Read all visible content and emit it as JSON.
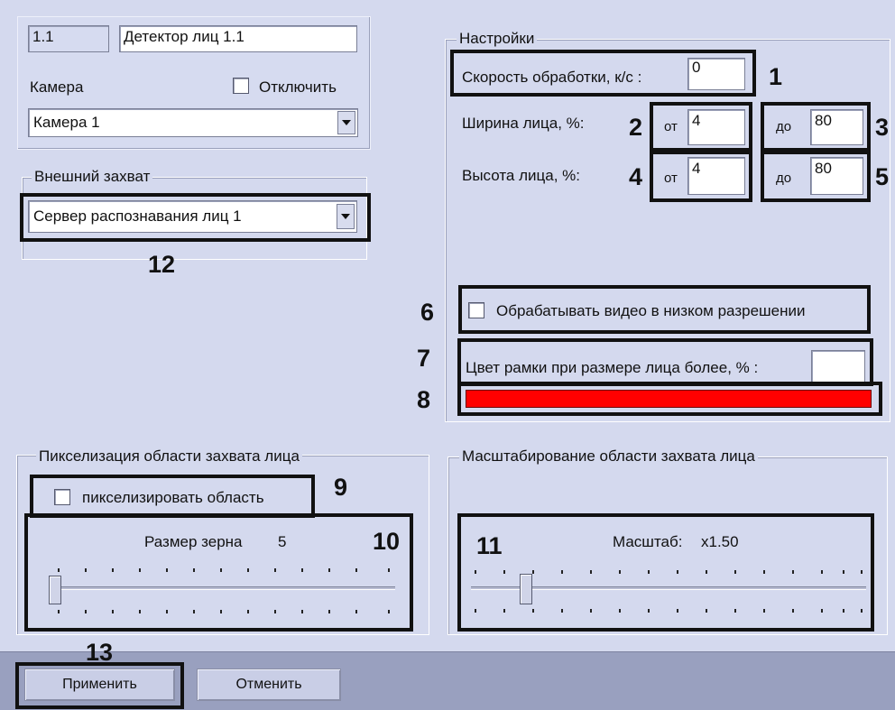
{
  "top_panel": {
    "id_value": "1.1",
    "name_value": "Детектор лиц 1.1",
    "camera_label": "Камера",
    "disable_label": "Отключить",
    "camera_selected": "Камера 1"
  },
  "external_capture": {
    "legend": "Внешний захват",
    "selected": "Сервер распознавания лиц 1"
  },
  "settings": {
    "legend": "Настройки",
    "speed_label": "Скорость обработки, к/с :",
    "speed_value": "0",
    "width_label": "Ширина лица, %:",
    "height_label": "Высота лица, %:",
    "from_label": "от",
    "to_label": "до",
    "width_from": "4",
    "width_to": "80",
    "height_from": "4",
    "height_to": "80",
    "low_res_label": "Обрабатывать видео в низком разрешении",
    "frame_color_label": "Цвет рамки при размере лица более, % :",
    "frame_color_value": "",
    "frame_color": "#ff0000"
  },
  "pixelization": {
    "legend": "Пикселизация области захвата лица",
    "pixelize_label": "пикселизировать область",
    "grain_label": "Размер зерна",
    "grain_value": "5"
  },
  "scaling": {
    "legend": "Масштабирование области захвата лица",
    "scale_label": "Масштаб:",
    "scale_value": "x1.50"
  },
  "buttons": {
    "apply": "Применить",
    "cancel": "Отменить"
  },
  "callouts": [
    "1",
    "2",
    "3",
    "4",
    "5",
    "6",
    "7",
    "8",
    "9",
    "10",
    "11",
    "12",
    "13"
  ]
}
